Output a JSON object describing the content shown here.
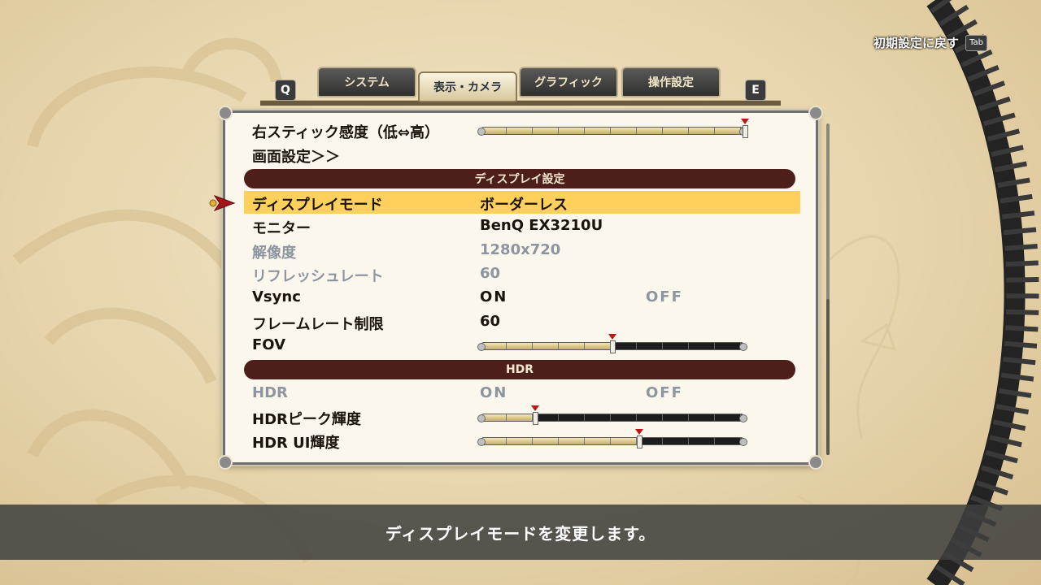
{
  "reset": {
    "label": "初期設定に戻す",
    "key": "Tab"
  },
  "tabs": {
    "prev_key": "Q",
    "next_key": "E",
    "items": [
      {
        "label": "システム",
        "active": false
      },
      {
        "label": "表示・カメラ",
        "active": true
      },
      {
        "label": "グラフィック",
        "active": false
      },
      {
        "label": "操作設定",
        "active": false
      }
    ]
  },
  "settings": {
    "right_stick_sensitivity": {
      "label": "右スティック感度（低⇔高）",
      "level": 1.0
    },
    "screen_settings_link": {
      "label": "画面設定＞＞"
    },
    "display_section": {
      "title": "ディスプレイ設定"
    },
    "display_mode": {
      "label": "ディスプレイモード",
      "value": "ボーダーレス"
    },
    "monitor": {
      "label": "モニター",
      "value": "BenQ EX3210U"
    },
    "resolution": {
      "label": "解像度",
      "value": "1280x720"
    },
    "refresh_rate": {
      "label": "リフレッシュレート",
      "value": "60"
    },
    "vsync": {
      "label": "Vsync",
      "on": "ON",
      "off": "OFF"
    },
    "frame_rate_limit": {
      "label": "フレームレート制限",
      "value": "60"
    },
    "fov": {
      "label": "FOV",
      "level": 0.5
    },
    "hdr_section": {
      "title": "HDR"
    },
    "hdr": {
      "label": "HDR",
      "on": "ON",
      "off": "OFF"
    },
    "hdr_peak_brightness": {
      "label": "HDRピーク輝度",
      "level": 0.21
    },
    "hdr_ui_brightness": {
      "label": "HDR UI輝度",
      "level": 0.6
    }
  },
  "hint": {
    "text": "ディスプレイモードを変更します。"
  },
  "colors": {
    "highlight": "#ffd15c",
    "section": "#4d1e1a",
    "marker": "#c11414",
    "disabled": "#8d95a0"
  }
}
